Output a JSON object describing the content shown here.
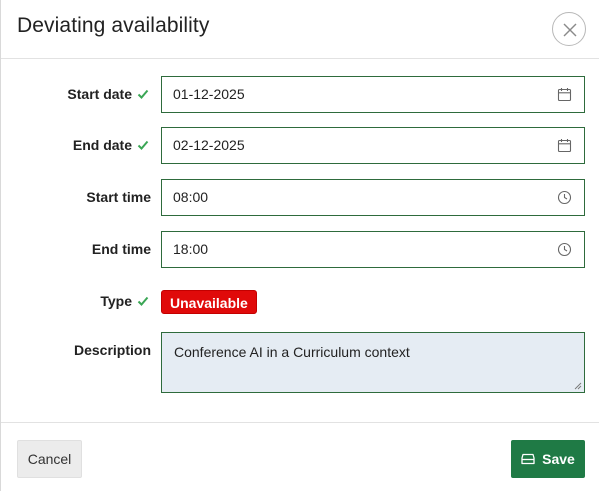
{
  "dialog": {
    "title": "Deviating availability",
    "close_icon": "close-icon"
  },
  "form": {
    "start_date": {
      "label": "Start date",
      "value": "01-12-2025",
      "valid": true,
      "icon": "calendar-icon"
    },
    "end_date": {
      "label": "End date",
      "value": "02-12-2025",
      "valid": true,
      "icon": "calendar-icon"
    },
    "start_time": {
      "label": "Start time",
      "value": "08:00",
      "icon": "clock-icon"
    },
    "end_time": {
      "label": "End time",
      "value": "18:00",
      "icon": "clock-icon"
    },
    "type": {
      "label": "Type",
      "value": "Unavailable",
      "valid": true,
      "badge_color": "#e00a0a"
    },
    "description": {
      "label": "Description",
      "value": "Conference AI in a Curriculum context"
    }
  },
  "footer": {
    "cancel_label": "Cancel",
    "save_label": "Save",
    "save_icon": "save-icon",
    "save_color": "#1f7a45"
  },
  "colors": {
    "valid_check": "#3aa655",
    "field_border": "#2e6b3c",
    "description_bg": "#e5ecf3"
  }
}
